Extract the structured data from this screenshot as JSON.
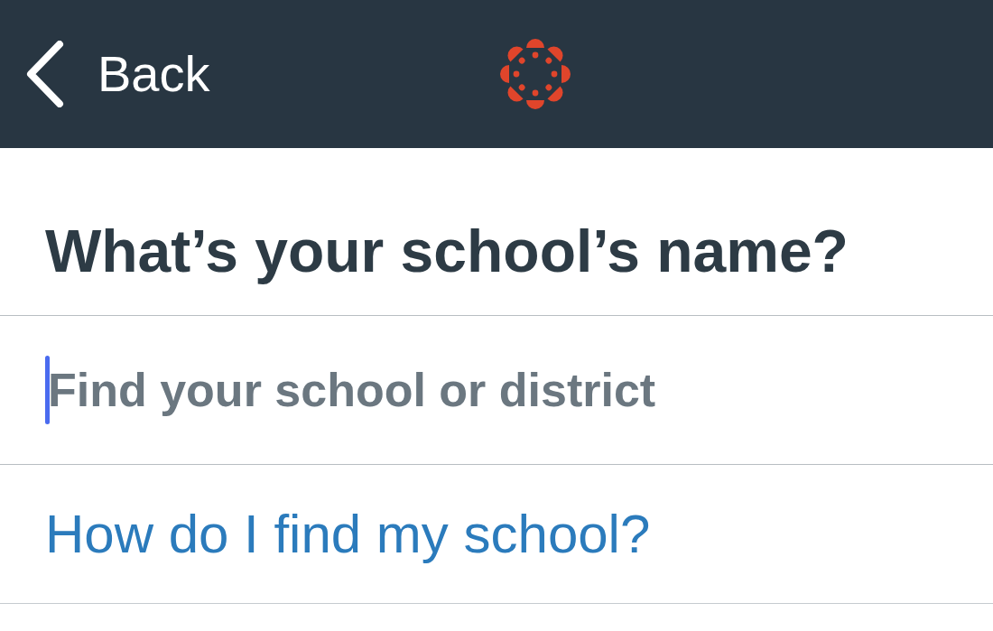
{
  "header": {
    "back_label": "Back"
  },
  "title": "What’s your school’s name?",
  "search": {
    "placeholder": "Find your school or district",
    "focused": true
  },
  "help_link": "How do I find my school?"
}
